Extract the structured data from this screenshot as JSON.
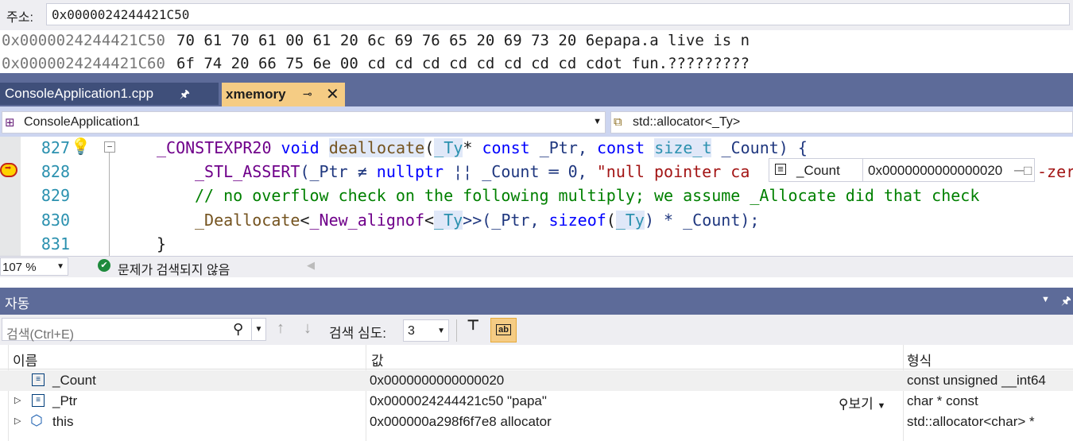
{
  "memory": {
    "address_label": "주소:",
    "address_value": "0x0000024244421C50",
    "rows": [
      {
        "addr": "0x0000024244421C50",
        "bytes": "70 61 70 61 00 61 20 6c 69 76 65 20 69 73 20 6e",
        "text": "papa.a live is n"
      },
      {
        "addr": "0x0000024244421C60",
        "bytes": "6f 74 20 66 75 6e 00 cd cd cd cd cd cd cd cd cd",
        "text": "ot fun.?????????"
      }
    ]
  },
  "tabs": [
    {
      "label": "ConsoleApplication1.cpp",
      "active": false
    },
    {
      "label": "xmemory",
      "active": true
    }
  ],
  "nav": {
    "project": "ConsoleApplication1",
    "scope": "std::allocator<_Ty>"
  },
  "code": {
    "lines": [
      {
        "num": "827"
      },
      {
        "num": "828"
      },
      {
        "num": "829"
      },
      {
        "num": "830"
      },
      {
        "num": "831"
      }
    ],
    "line827": {
      "a": "_CONSTEXPR20",
      "b": " ",
      "c": "void",
      "d": " ",
      "e": "deallocate",
      "f": "(",
      "g": "_Ty",
      "h": "* ",
      "i": "const",
      "j": " _Ptr, ",
      "k": "const",
      "l": " ",
      "m": "size_t",
      "n": " _Count) {"
    },
    "line828": {
      "a": "_STL_ASSERT",
      "b": "(_Ptr ≠ ",
      "c": "nullptr",
      "d": " ¦¦ _Count ═ 0, ",
      "e": "\"null pointer ca"
    },
    "line828_tail": "-zer",
    "line829": "// no overflow check on the following multiply; we assume _Allocate did that check",
    "line830": {
      "a": "_Deallocate",
      "b": "<",
      "c": "_New_alignof",
      "d": "<",
      "e": "_Ty",
      "f": ">>(_Ptr, ",
      "g": "sizeof",
      "h": "(",
      "i": "_Ty",
      "j": ") * _Count);"
    },
    "line831": "}"
  },
  "datatip": {
    "name": "_Count",
    "value": "0x0000000000000020",
    "pin": "─□"
  },
  "status": {
    "zoom": "107 %",
    "issues": "문제가 검색되지 않음"
  },
  "autos": {
    "title": "자동",
    "search_placeholder": "검색(Ctrl+E)",
    "depth_label": "검색 심도:",
    "depth_value": "3",
    "columns": {
      "name": "이름",
      "value": "값",
      "type": "형식"
    },
    "rows": [
      {
        "name": "_Count",
        "value": "0x0000000000000020",
        "type": "const unsigned __int64",
        "expandable": false
      },
      {
        "name": "_Ptr",
        "value": "0x0000024244421c50 \"papa\"",
        "type": "char * const",
        "expandable": true,
        "view": "보기"
      },
      {
        "name": "this",
        "value": "0x000000a298f6f7e8 allocator",
        "type": "std::allocator<char> *",
        "expandable": true
      }
    ]
  },
  "colors": {
    "tab_strip": "#5d6b99",
    "active_tab": "#f5cc84",
    "keyword": "#0000ff",
    "type": "#2b91af",
    "string": "#a31515",
    "comment": "#008000",
    "macro": "#6f008a"
  }
}
